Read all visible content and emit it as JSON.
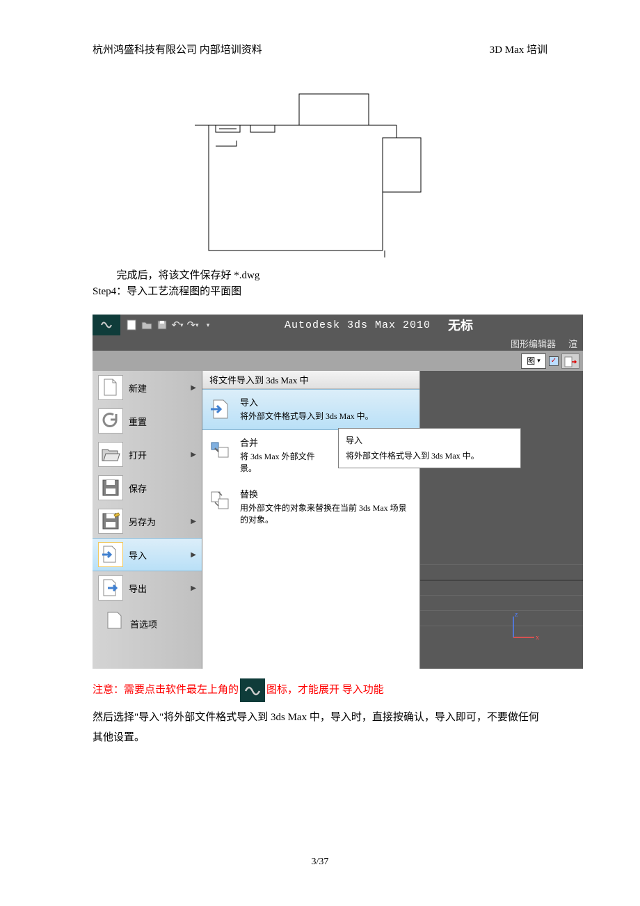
{
  "header": {
    "left": "杭州鸿盛科技有限公司 内部培训资料",
    "right": "3D Max 培训"
  },
  "body": {
    "save_line": "完成后，将该文件保存好 *.dwg",
    "step4": "Step4：导入工艺流程图的平面图"
  },
  "app": {
    "title": "Autodesk 3ds Max  2010",
    "untitled": "无标",
    "menubar_item": "图形编辑器",
    "menubar_item2": "渲",
    "toolbar_dropdown": "图",
    "left_menu": {
      "new": "新建",
      "reset": "重置",
      "open": "打开",
      "save": "保存",
      "saveas": "另存为",
      "import": "导入",
      "export": "导出",
      "preferences": "首选项"
    },
    "submenu": {
      "header": "将文件导入到 3ds Max 中",
      "import": {
        "title": "导入",
        "desc": "将外部文件格式导入到 3ds Max 中。"
      },
      "merge": {
        "title": "合并",
        "desc_pre": "将 3ds Max 外部文件",
        "desc_post": "景。"
      },
      "replace": {
        "title": "替换",
        "desc": "用外部文件的对象来替换在当前 3ds Max 场景的对象。"
      }
    },
    "tooltip": {
      "title": "导入",
      "desc": "将外部文件格式导入到 3ds Max 中。"
    },
    "axis": {
      "z": "z",
      "x": "x"
    }
  },
  "note": {
    "prefix": "注意：需要点击软件最左上角的",
    "suffix": "图标，才能展开 导入功能",
    "para": "然后选择\"导入\"将外部文件格式导入到 3ds Max 中，导入时，直接按确认，导入即可，不要做任何其他设置。"
  },
  "footer": "3/37"
}
